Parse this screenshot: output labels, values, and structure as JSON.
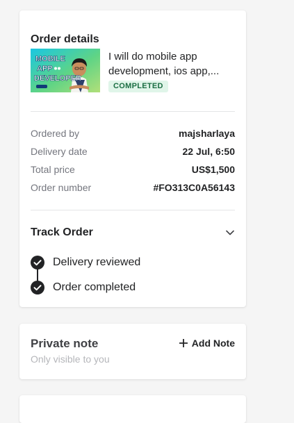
{
  "order_details": {
    "title": "Order details",
    "gig_title": "I will do mobile app development, ios app,...",
    "thumbnail_text": [
      "MOBILE",
      "APP",
      "DEVELOPER"
    ],
    "status": "COMPLETED",
    "rows": [
      {
        "label": "Ordered by",
        "value": "majsharlaya"
      },
      {
        "label": "Delivery date",
        "value": "22 Jul, 6:50"
      },
      {
        "label": "Total price",
        "value": "US$1,500"
      },
      {
        "label": "Order number",
        "value": "#FO313C0A56143"
      }
    ]
  },
  "track_order": {
    "title": "Track Order",
    "toggle_icon": "chevron-down-icon",
    "steps": [
      {
        "label": "Delivery reviewed",
        "icon": "check-circle-icon"
      },
      {
        "label": "Order completed",
        "icon": "check-circle-icon"
      }
    ]
  },
  "private_note": {
    "title": "Private note",
    "subtitle": "Only visible to you",
    "add_label": "Add Note",
    "add_icon": "plus-icon"
  },
  "colors": {
    "badge_bg": "#e0f5e9",
    "badge_text": "#1b6e43",
    "text_primary": "#222325",
    "text_secondary": "#74767e",
    "page_bg": "#f5f5f5"
  }
}
